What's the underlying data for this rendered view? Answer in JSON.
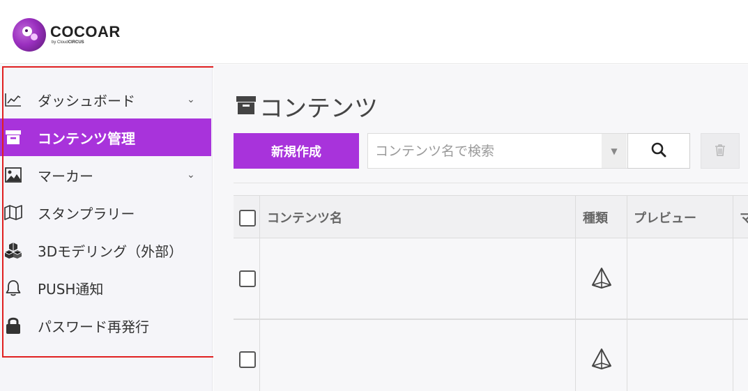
{
  "app": {
    "logo_title": "COCOAR",
    "logo_sub_prefix": "by Cloud",
    "logo_sub_brand": "CIRCUS"
  },
  "sidebar": {
    "items": [
      {
        "label": "ダッシュボード",
        "icon": "chart-line-icon",
        "has_submenu": true,
        "active": false
      },
      {
        "label": "コンテンツ管理",
        "icon": "archive-box-icon",
        "has_submenu": false,
        "active": true
      },
      {
        "label": "マーカー",
        "icon": "image-icon",
        "has_submenu": true,
        "active": false
      },
      {
        "label": "スタンプラリー",
        "icon": "map-icon",
        "has_submenu": false,
        "active": false
      },
      {
        "label": "3Dモデリング（外部）",
        "icon": "cubes-icon",
        "has_submenu": false,
        "active": false
      },
      {
        "label": "PUSH通知",
        "icon": "bell-icon",
        "has_submenu": false,
        "active": false
      },
      {
        "label": "パスワード再発行",
        "icon": "lock-icon",
        "has_submenu": false,
        "active": false
      }
    ],
    "chevron": "⌄"
  },
  "main": {
    "page_title": "コンテンツ",
    "new_button_label": "新規作成",
    "search": {
      "value": "",
      "placeholder": "コンテンツ名で検索"
    }
  },
  "table": {
    "columns": [
      "コンテンツ名",
      "種類",
      "プレビュー",
      "マ"
    ],
    "rows": [
      {
        "name": "",
        "type_icon": "pyramid-3d-icon",
        "preview": ""
      },
      {
        "name": "",
        "type_icon": "pyramid-3d-icon",
        "preview": ""
      }
    ]
  },
  "colors": {
    "accent": "#a833db",
    "highlight_border": "#e02020",
    "sidebar_bg": "#f5f5f9"
  }
}
